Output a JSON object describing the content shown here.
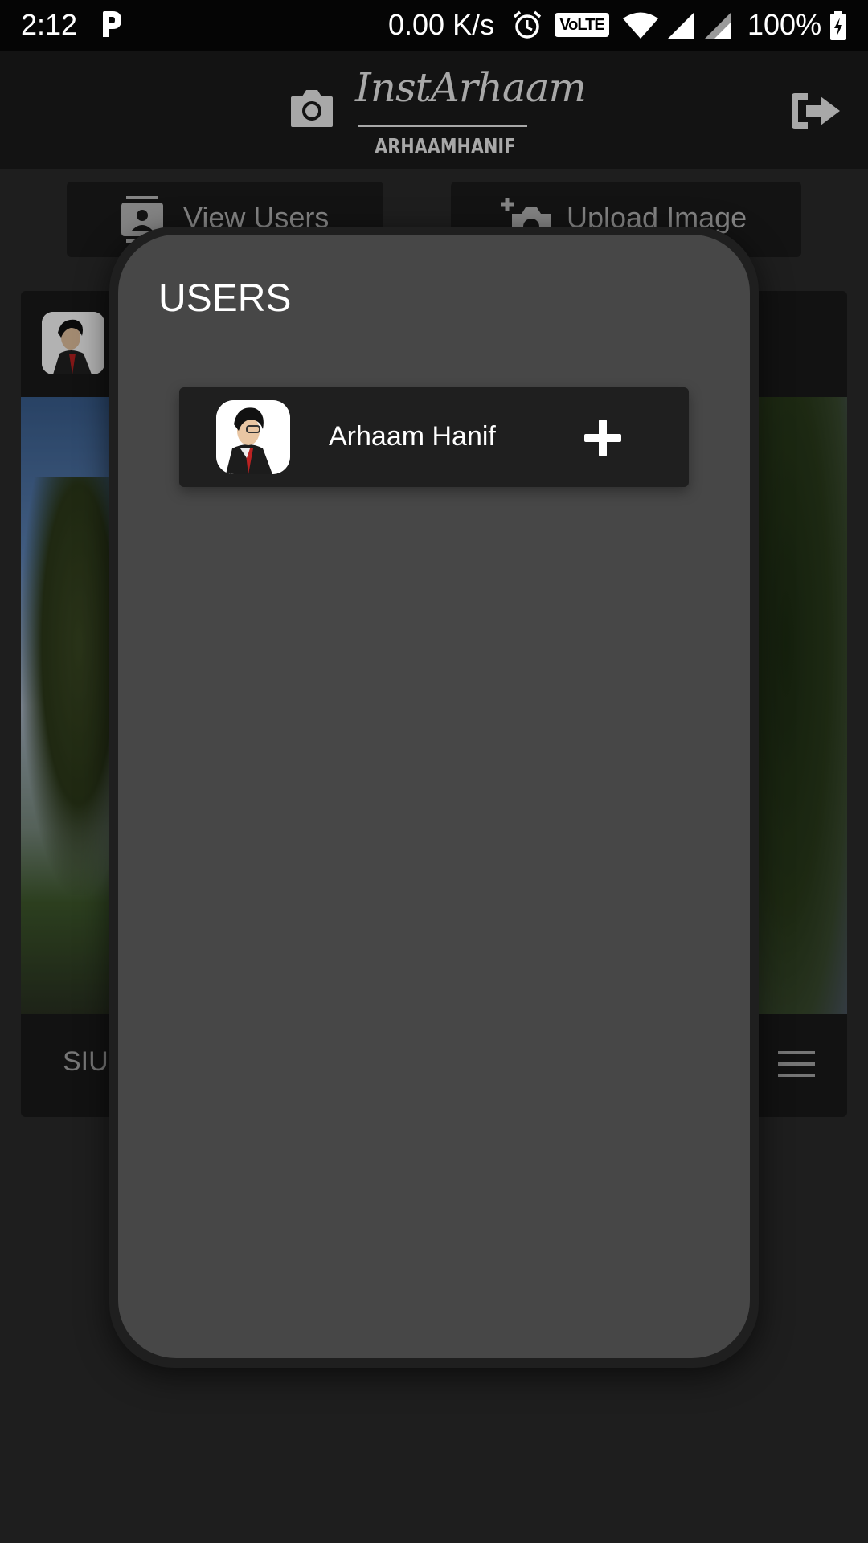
{
  "status_bar": {
    "time": "2:12",
    "network_speed": "0.00 K/s",
    "volte_label": "VoLTE",
    "battery": "100%"
  },
  "header": {
    "app_title": "InstArhaam",
    "username": "ARHAAMHANIF"
  },
  "background": {
    "view_users_label": "View Users",
    "upload_image_label": "Upload Image",
    "post_caption_partial": "SIU"
  },
  "dialog": {
    "title": "USERS",
    "users": [
      {
        "name": "Arhaam Hanif",
        "action_icon": "plus-icon"
      }
    ]
  },
  "colors": {
    "status_bar_bg": "#050505",
    "header_bg": "#131313",
    "dialog_bg": "#474747",
    "row_bg": "#1f1f1f"
  }
}
